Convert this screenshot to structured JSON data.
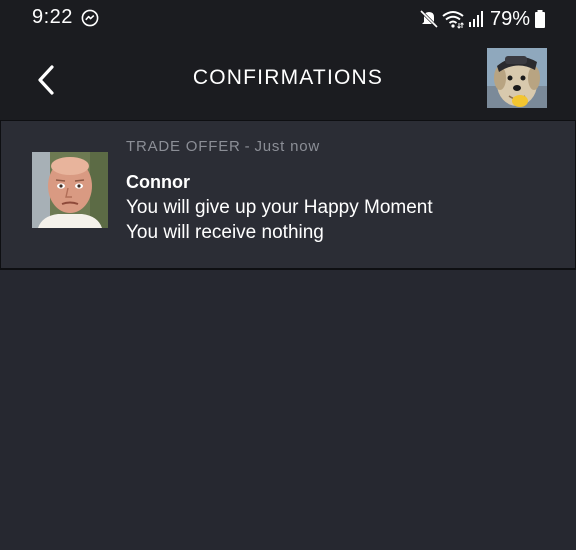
{
  "status_bar": {
    "time": "9:22",
    "battery": "79%",
    "icons": [
      "messenger-icon",
      "mute-icon",
      "wifi-icon",
      "signal-icon",
      "battery-icon"
    ]
  },
  "header": {
    "title": "CONFIRMATIONS",
    "back_icon": "chevron-left-icon",
    "avatar": "user-avatar-dog"
  },
  "confirmations": [
    {
      "type": "TRADE OFFER",
      "time": "Just now",
      "name": "Connor",
      "give": "You will give up your Happy Moment",
      "receive": "You will receive nothing",
      "avatar": "connor-avatar"
    }
  ],
  "colors": {
    "background": "#262830",
    "header_bg": "#1b1c20",
    "card_bg": "#2b2d35",
    "meta_text": "#8b8e96"
  }
}
